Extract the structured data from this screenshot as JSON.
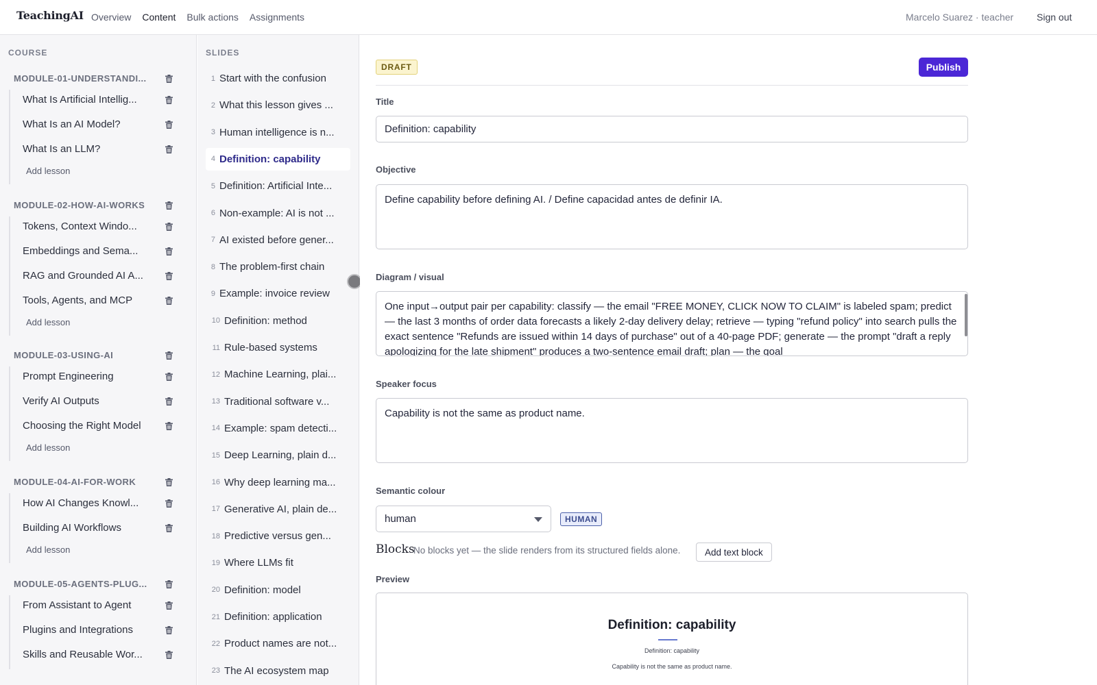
{
  "app": {
    "logo": "TeachingAI",
    "nav": [
      "Overview",
      "Content",
      "Bulk actions",
      "Assignments"
    ],
    "active_nav": "Content",
    "user": "Marcelo Suarez · teacher",
    "sign_out": "Sign out"
  },
  "course": {
    "heading": "COURSE",
    "add_lesson_label": "Add lesson",
    "modules": [
      {
        "title": "MODULE-01-UNDERSTANDI...",
        "lessons": [
          "What Is Artificial Intellig...",
          "What Is an AI Model?",
          "What Is an LLM?"
        ]
      },
      {
        "title": "MODULE-02-HOW-AI-WORKS",
        "lessons": [
          "Tokens, Context Windo...",
          "Embeddings and Sema...",
          "RAG and Grounded AI A...",
          "Tools, Agents, and MCP"
        ]
      },
      {
        "title": "MODULE-03-USING-AI",
        "lessons": [
          "Prompt Engineering",
          "Verify AI Outputs",
          "Choosing the Right Model"
        ]
      },
      {
        "title": "MODULE-04-AI-FOR-WORK",
        "lessons": [
          "How AI Changes Knowl...",
          "Building AI Workflows"
        ]
      },
      {
        "title": "MODULE-05-AGENTS-PLUG...",
        "lessons": [
          "From Assistant to Agent",
          "Plugins and Integrations",
          "Skills and Reusable Wor..."
        ]
      }
    ]
  },
  "slides": {
    "heading": "SLIDES",
    "active_index": 4,
    "items": [
      {
        "n": "1",
        "title": "Start with the confusion"
      },
      {
        "n": "2",
        "title": "What this lesson gives ..."
      },
      {
        "n": "3",
        "title": "Human intelligence is n..."
      },
      {
        "n": "4",
        "title": "Definition: capability"
      },
      {
        "n": "5",
        "title": "Definition: Artificial Inte..."
      },
      {
        "n": "6",
        "title": "Non-example: AI is not ..."
      },
      {
        "n": "7",
        "title": "AI existed before gener..."
      },
      {
        "n": "8",
        "title": "The problem-first chain"
      },
      {
        "n": "9",
        "title": "Example: invoice review"
      },
      {
        "n": "10",
        "title": "Definition: method"
      },
      {
        "n": "11",
        "title": "Rule-based systems"
      },
      {
        "n": "12",
        "title": "Machine Learning, plai..."
      },
      {
        "n": "13",
        "title": "Traditional software v..."
      },
      {
        "n": "14",
        "title": "Example: spam detecti..."
      },
      {
        "n": "15",
        "title": "Deep Learning, plain d..."
      },
      {
        "n": "16",
        "title": "Why deep learning ma..."
      },
      {
        "n": "17",
        "title": "Generative AI, plain de..."
      },
      {
        "n": "18",
        "title": "Predictive versus gen..."
      },
      {
        "n": "19",
        "title": "Where LLMs fit"
      },
      {
        "n": "20",
        "title": "Definition: model"
      },
      {
        "n": "21",
        "title": "Definition: application"
      },
      {
        "n": "22",
        "title": "Product names are not..."
      },
      {
        "n": "23",
        "title": "The AI ecosystem map"
      }
    ]
  },
  "editor": {
    "status": "DRAFT",
    "publish_label": "Publish",
    "title_label": "Title",
    "title_value": "Definition: capability",
    "objective_label": "Objective",
    "objective_value": "Define capability before defining AI. / Define capacidad antes de definir IA.",
    "diagram_label": "Diagram / visual",
    "diagram_value": "One input→output pair per capability: classify — the email \"FREE MONEY, CLICK NOW TO CLAIM\" is labeled spam; predict — the last 3 months of order data forecasts a likely 2-day delivery delay; retrieve — typing \"refund policy\" into search pulls the exact sentence \"Refunds are issued within 14 days of purchase\" out of a 40-page PDF; generate — the prompt \"draft a reply apologizing for the late shipment\" produces a two-sentence email draft; plan — the goal",
    "speaker_label": "Speaker focus",
    "speaker_value": "Capability is not the same as product name.",
    "semantic_label": "Semantic colour",
    "semantic_value": "human",
    "semantic_badge": "HUMAN",
    "blocks_title": "Blocks",
    "blocks_note": "No blocks yet — the slide renders from its structured fields alone.",
    "add_text_block": "Add text block",
    "preview_label": "Preview",
    "preview": {
      "title": "Definition: capability",
      "subtitle": "Definition: capability",
      "note": "Capability is not the same as product name."
    }
  },
  "colors": {
    "accent": "#4b27d6",
    "active_slide": "#2e2a8a",
    "draft_badge": "#fbf4cf",
    "human_badge": "#e8ecfb"
  }
}
